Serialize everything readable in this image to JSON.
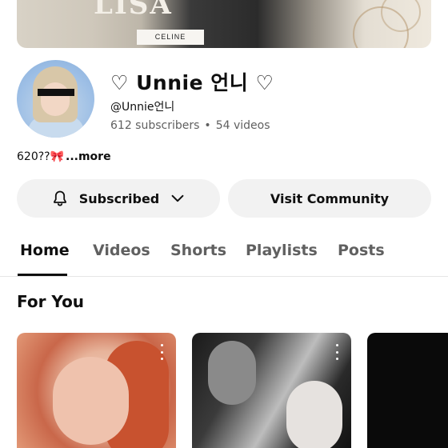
{
  "banner": {
    "text": "LISA",
    "brand": "CELINE"
  },
  "channel": {
    "name": "♡ Unnie 언니 ♡",
    "handle": "@Unnie언니",
    "subscribers": "612 subscribers",
    "dot": "•",
    "videos": "54 videos"
  },
  "description": {
    "text": "620??🎀",
    "more_label": "...more"
  },
  "actions": {
    "subscribed_label": "Subscribed",
    "visit_label": "Visit Community"
  },
  "tabs": [
    {
      "label": "Home",
      "active": true
    },
    {
      "label": "Videos",
      "active": false
    },
    {
      "label": "Shorts",
      "active": false
    },
    {
      "label": "Playlists",
      "active": false
    },
    {
      "label": "Posts",
      "active": false
    }
  ],
  "sections": {
    "for_you_title": "For You"
  },
  "icons": {
    "bell": "bell-icon",
    "chevron": "chevron-down-icon",
    "more": "more-vert-icon"
  },
  "colors": {
    "text": "#0f0f0f",
    "secondary": "#606060",
    "button_bg": "#f2f2f2"
  }
}
